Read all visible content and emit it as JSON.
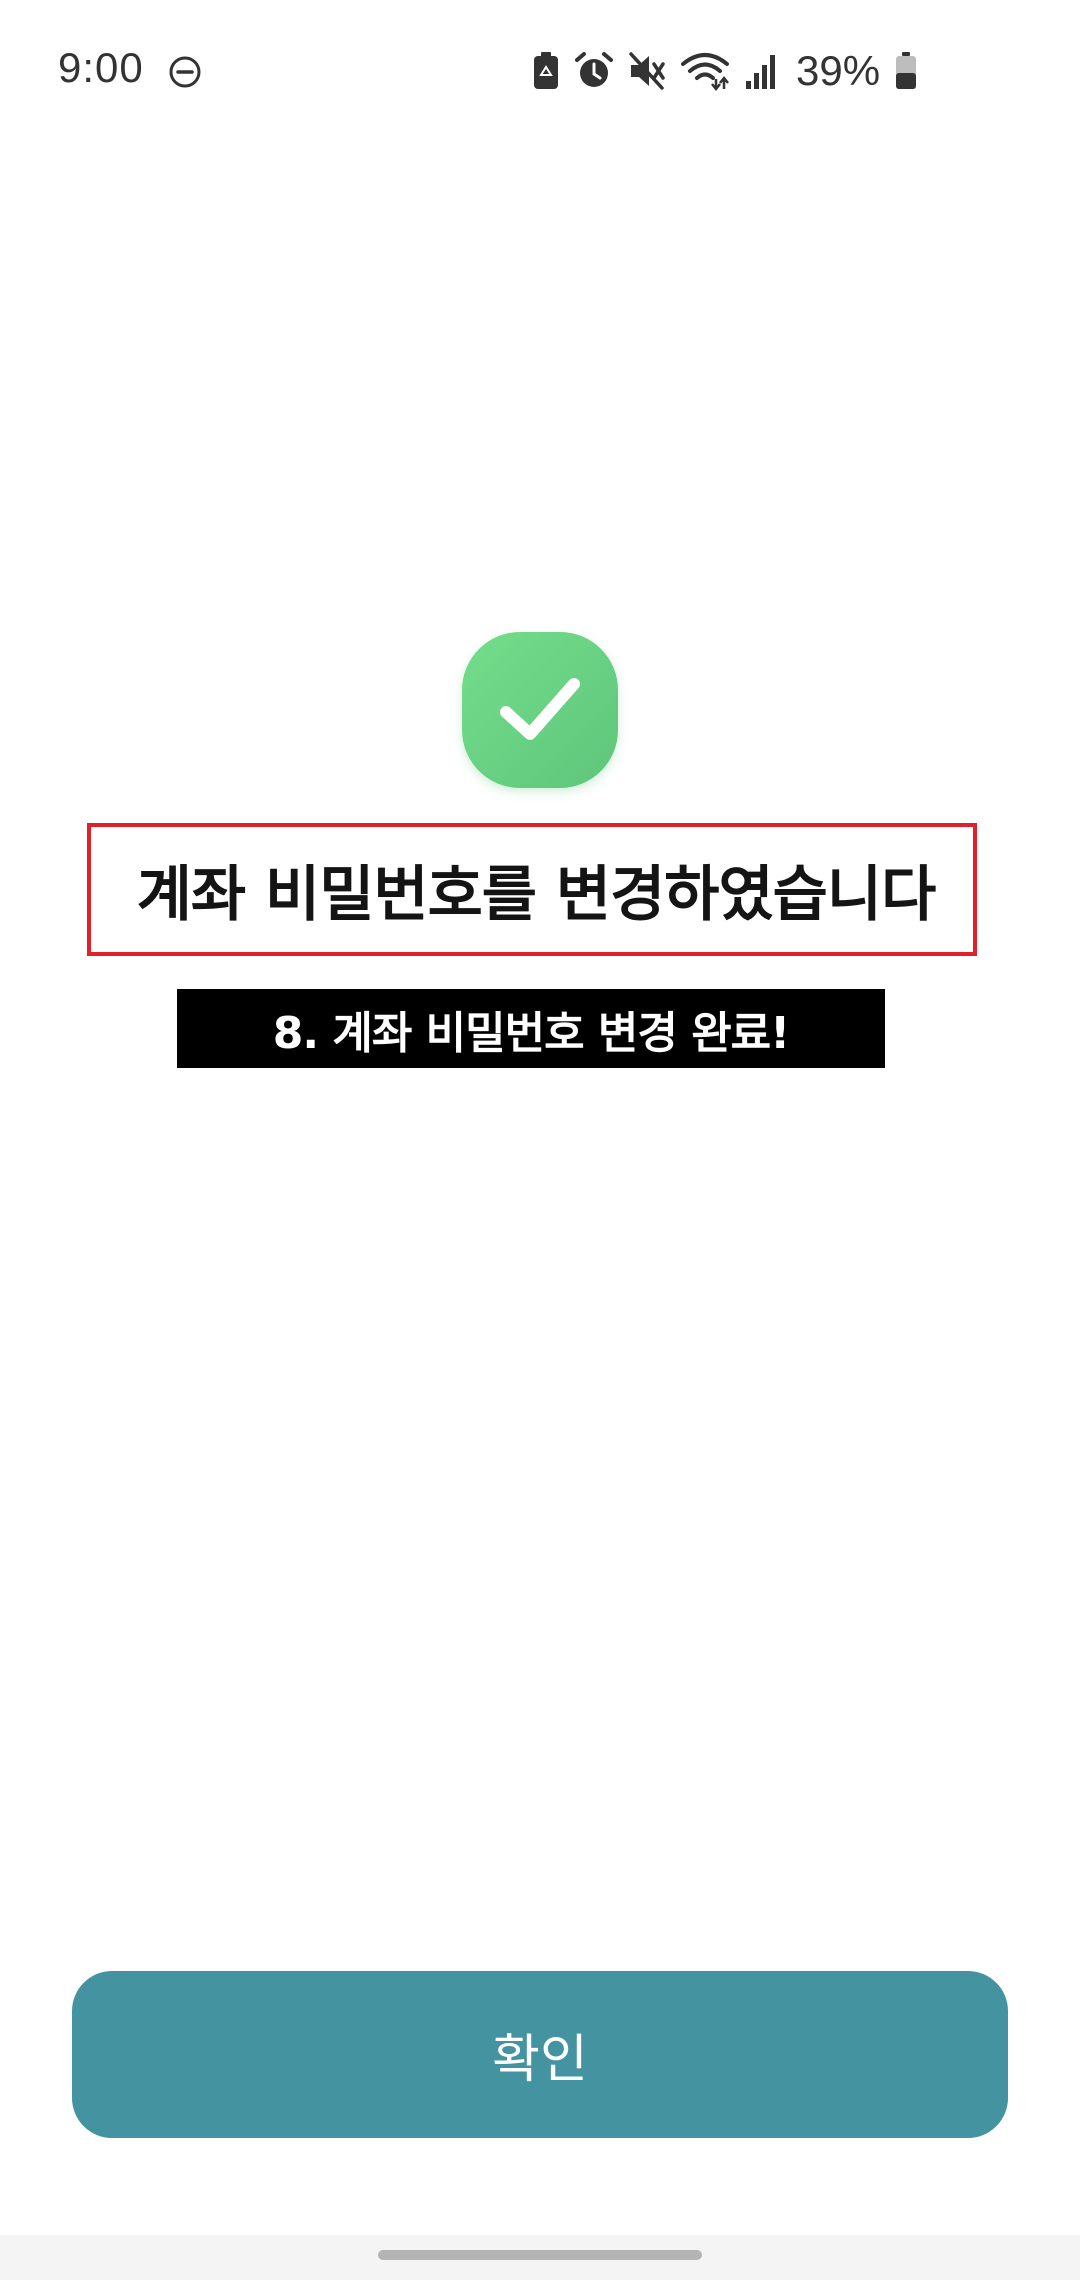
{
  "status_bar": {
    "time": "9:00",
    "battery_percent": "39%",
    "icons": [
      "do-not-disturb-icon",
      "battery-saver-icon",
      "alarm-icon",
      "mute-icon",
      "wifi-icon",
      "signal-icon",
      "battery-icon"
    ]
  },
  "success": {
    "icon": "check-icon",
    "color": "#6fd685",
    "message": "계좌 비밀번호를 변경하였습니다"
  },
  "caption": {
    "text": "8. 계좌 비밀번호 변경 완료!"
  },
  "confirm_button": {
    "label": "확인",
    "color": "#4393a0"
  },
  "highlight_color": "#e0202a"
}
